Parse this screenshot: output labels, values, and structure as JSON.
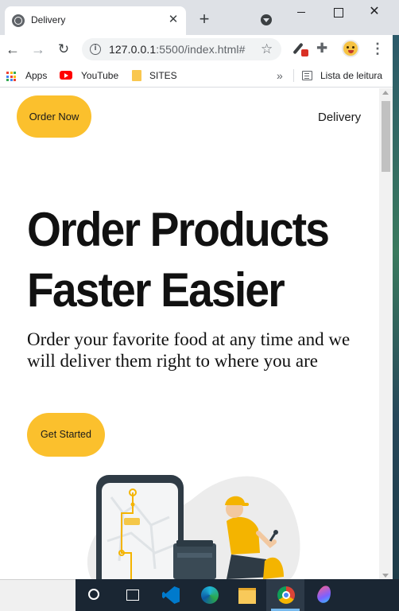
{
  "browser": {
    "tab_title": "Delivery",
    "tab_close": "✕",
    "new_tab": "+",
    "url_host": "127.0.0.1",
    "url_path": ":5500/index.html#",
    "info_icon": "i",
    "star": "☆",
    "menu": "⋮",
    "bookmarks": {
      "apps": "Apps",
      "youtube": "YouTube",
      "sites": "SITES",
      "more": "»",
      "reading_list": "Lista de leitura"
    },
    "nav": {
      "back": "←",
      "forward": "→",
      "reload": "↻"
    },
    "window": {
      "close": "✕"
    }
  },
  "page": {
    "order_now": "Order Now",
    "nav_delivery": "Delivery",
    "hero_title_line1": "Order Products",
    "hero_title_line2": "Faster Easier",
    "hero_subtitle": "Order your favorite food at any time and we will deliver them right to where you are",
    "cta": "Get Started"
  },
  "colors": {
    "accent": "#fbc02d",
    "tab_bar": "#dee1e6",
    "taskbar": "#1a2633"
  },
  "icons": {
    "puzzle": "🧩"
  }
}
